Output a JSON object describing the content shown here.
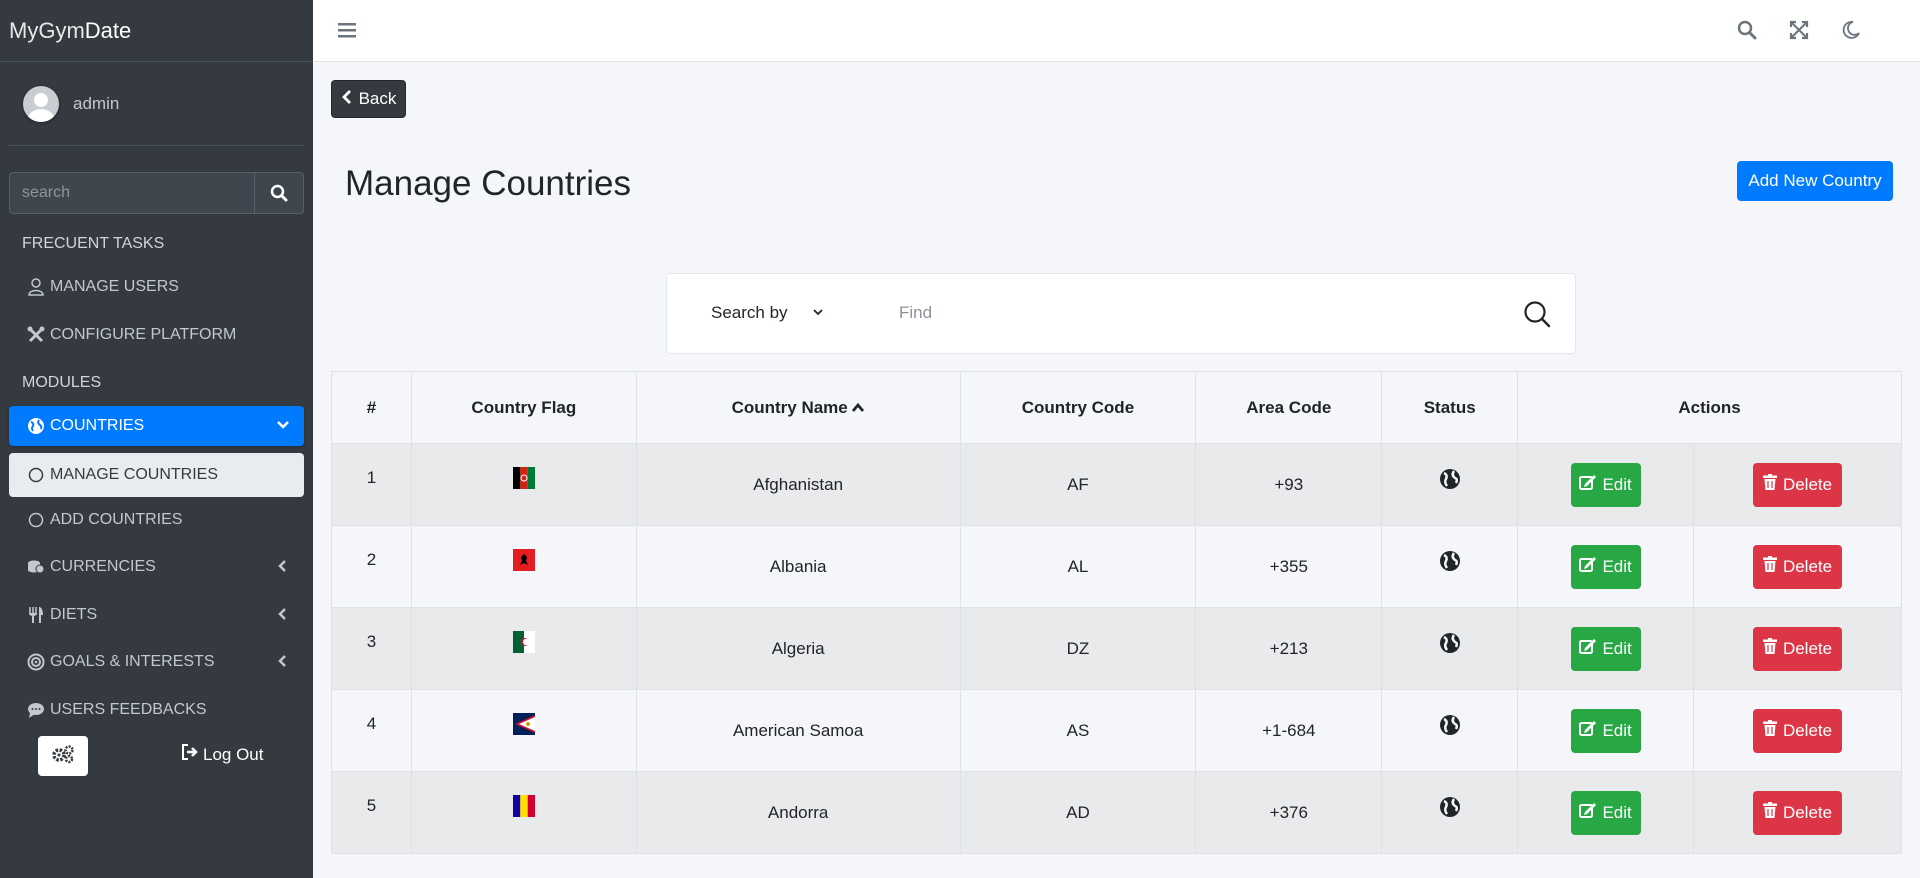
{
  "brand": {
    "part1": "MyGym",
    "part2": "Date"
  },
  "user": {
    "name": "admin"
  },
  "sidebar": {
    "search_placeholder": "search",
    "frequent_header": "FRECUENT TASKS",
    "modules_header": "MODULES",
    "items": [
      {
        "label": "MANAGE USERS",
        "icon": "user-icon"
      },
      {
        "label": "CONFIGURE PLATFORM",
        "icon": "tools-icon"
      },
      {
        "label": "COUNTRIES",
        "icon": "globe-icon"
      },
      {
        "label": "MANAGE COUNTRIES",
        "icon": "circle-icon"
      },
      {
        "label": "ADD COUNTRIES",
        "icon": "circle-icon"
      },
      {
        "label": "CURRENCIES",
        "icon": "coins-icon"
      },
      {
        "label": "DIETS",
        "icon": "utensils-icon"
      },
      {
        "label": "GOALS & INTERESTS",
        "icon": "bullseye-icon"
      },
      {
        "label": "USERS FEEDBACKS",
        "icon": "comment-icon"
      }
    ],
    "logout_label": "Log Out"
  },
  "content": {
    "back_label": "Back",
    "title": "Manage Countries",
    "add_label": "Add New Country",
    "search_by_label": "Search by",
    "find_placeholder": "Find"
  },
  "table": {
    "headers": [
      "#",
      "Country Flag",
      "Country Name",
      "Country Code",
      "Area Code",
      "Status",
      "Actions"
    ],
    "edit_label": "Edit",
    "delete_label": "Delete",
    "rows": [
      {
        "num": "1",
        "name": "Afghanistan",
        "code": "AF",
        "area": "+93",
        "flag": "af"
      },
      {
        "num": "2",
        "name": "Albania",
        "code": "AL",
        "area": "+355",
        "flag": "al"
      },
      {
        "num": "3",
        "name": "Algeria",
        "code": "DZ",
        "area": "+213",
        "flag": "dz"
      },
      {
        "num": "4",
        "name": "American Samoa",
        "code": "AS",
        "area": "+1-684",
        "flag": "as"
      },
      {
        "num": "5",
        "name": "Andorra",
        "code": "AD",
        "area": "+376",
        "flag": "ad"
      }
    ]
  },
  "colors": {
    "primary": "#007bff",
    "success": "#28a745",
    "danger": "#dc3545",
    "sidebar": "#343a40"
  }
}
